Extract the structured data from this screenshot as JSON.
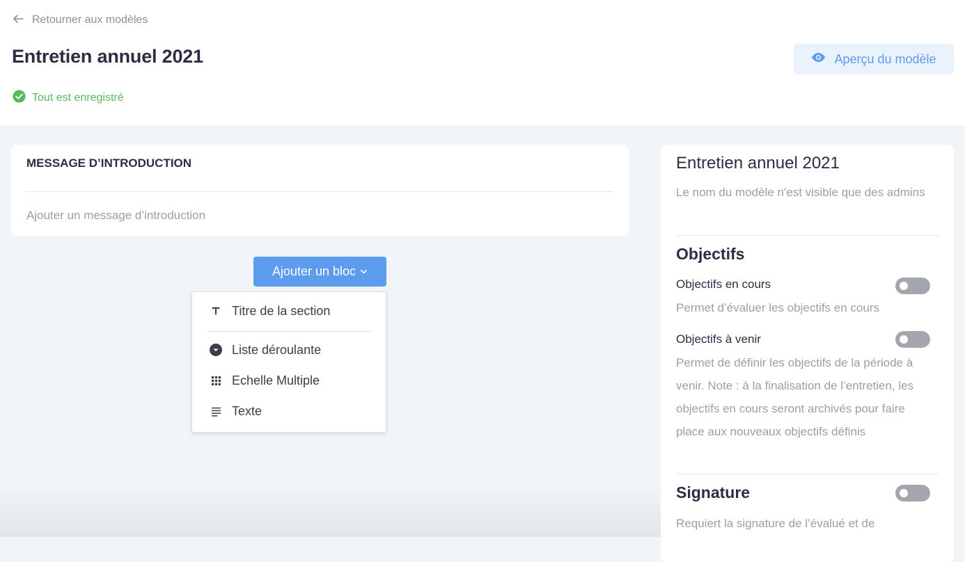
{
  "header": {
    "back_label": "Retourner aux modèles",
    "title": "Entretien annuel 2021",
    "save_status": "Tout est enregistré",
    "preview_label": "Aperçu du modèle"
  },
  "intro": {
    "heading": "MESSAGE D’INTRODUCTION",
    "placeholder": "Ajouter un message d’introduction"
  },
  "add_block": {
    "label": "Ajouter un bloc",
    "menu": [
      {
        "label": "Titre de la section",
        "icon": "text-title-icon"
      },
      {
        "label": "Liste déroulante",
        "icon": "dropdown-circle-icon"
      },
      {
        "label": "Echelle Multiple",
        "icon": "grid-icon"
      },
      {
        "label": "Texte",
        "icon": "text-lines-icon"
      }
    ]
  },
  "side_panel": {
    "title": "Entretien annuel 2021",
    "name_note": "Le nom du modèle n'est visible que des admins",
    "objectives_heading": "Objectifs",
    "current_objectives_label": "Objectifs en cours",
    "current_objectives_desc": "Permet d’évaluer les objectifs en cours",
    "upcoming_objectives_label": "Objectifs à venir",
    "upcoming_objectives_desc": "Permet de définir les objectifs de la période à venir. Note : à la finalisation de l’entretien, les objectifs en cours seront archivés pour faire place aux nouveaux objectifs définis",
    "signature_heading": "Signature",
    "signature_desc": "Requiert la signature de l’évalué et de"
  },
  "colors": {
    "accent": "#5d9cec",
    "success": "#5cb85c",
    "toggle_off": "#a3a6ad",
    "text_dark": "#2b2d42",
    "muted": "#9a9ea6"
  }
}
